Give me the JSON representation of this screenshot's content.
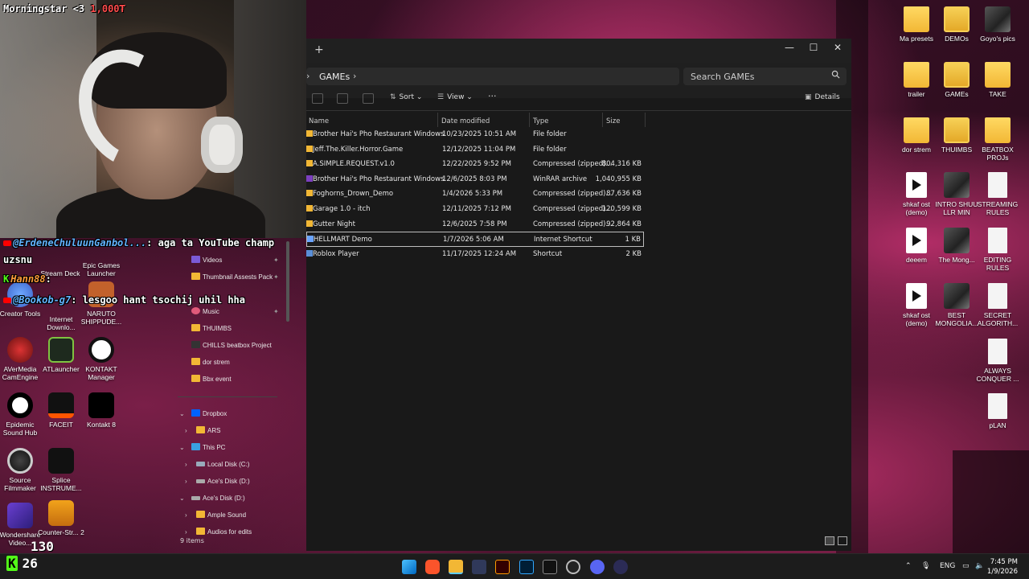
{
  "stream": {
    "donation_name": "Morningstar <3",
    "donation_amount": "1,000₮",
    "viewer_count": "26",
    "follower_counter": "130"
  },
  "chat": [
    {
      "user": "@ErdeneChuluunGanbol...",
      "text": ": aga ta YouTube champ",
      "cont": "uzsnu"
    },
    {
      "user": "Hann88",
      "text": ":"
    },
    {
      "user": "@Bookob-g7",
      "text": ": lesgoo hant tsochij uhil hha"
    }
  ],
  "desktop_left_icons": [
    {
      "label": "Stream Deck"
    },
    {
      "label": "Epic Games Launcher"
    },
    {
      "label": "Creator Tools"
    },
    {
      "label": "Internet Downlo..."
    },
    {
      "label": "NARUTO SHIPPUDE..."
    },
    {
      "label": "AVerMedia CamEngine"
    },
    {
      "label": "ATLauncher"
    },
    {
      "label": "KONTAKT Manager"
    },
    {
      "label": "Epidemic Sound Hub"
    },
    {
      "label": "FACEIT"
    },
    {
      "label": "Kontakt 8"
    },
    {
      "label": "Source Filmmaker"
    },
    {
      "label": "Splice INSTRUME..."
    },
    {
      "label": "Wondershare Video..."
    },
    {
      "label": "Counter-Str... 2"
    }
  ],
  "desktop_right_icons": [
    {
      "label": "Ma presets"
    },
    {
      "label": "DEMOs"
    },
    {
      "label": "Goyo's pics"
    },
    {
      "label": "trailer"
    },
    {
      "label": "GAMEs"
    },
    {
      "label": "TAKE"
    },
    {
      "label": "dor strem"
    },
    {
      "label": "THUIMBS"
    },
    {
      "label": "BEATBOX PROJs"
    },
    {
      "label": "shkaf ost (demo)"
    },
    {
      "label": "INTRO SHUU LLR MIN"
    },
    {
      "label": "STREAMING RULES"
    },
    {
      "label": "deeem"
    },
    {
      "label": "The Mong..."
    },
    {
      "label": "EDITING RULES"
    },
    {
      "label": "shkaf ost (demo)"
    },
    {
      "label": "BEST MONGOLIA..."
    },
    {
      "label": "SECRET ALGORITH..."
    },
    {
      "label": "ALWAYS CONQUER ..."
    },
    {
      "label": "pLAN"
    }
  ],
  "explorer": {
    "new_tab": "+",
    "breadcrumb": "GAMEs",
    "search_placeholder": "Search GAMEs",
    "toolbar": {
      "sort": "Sort",
      "view": "View",
      "more": "···",
      "details": "Details"
    },
    "columns": {
      "name": "Name",
      "date": "Date modified",
      "type": "Type",
      "size": "Size"
    },
    "files": [
      {
        "name": "Brother Hai's Pho Restaurant Windows",
        "date": "10/23/2025 10:51 AM",
        "type": "File folder",
        "size": "",
        "kind": "folder"
      },
      {
        "name": "Jeff.The.Killer.Horror.Game",
        "date": "12/12/2025 11:04 PM",
        "type": "File folder",
        "size": "",
        "kind": "folder"
      },
      {
        "name": "A.SIMPLE.REQUEST.v1.0",
        "date": "12/22/2025 9:52 PM",
        "type": "Compressed (zipped)...",
        "size": "804,316 KB",
        "kind": "zip"
      },
      {
        "name": "Brother Hai's Pho Restaurant Windows",
        "date": "12/6/2025 8:03 PM",
        "type": "WinRAR archive",
        "size": "1,040,955 KB",
        "kind": "rar"
      },
      {
        "name": "Foghorns_Drown_Demo",
        "date": "1/4/2026 5:33 PM",
        "type": "Compressed (zipped)...",
        "size": "87,636 KB",
        "kind": "zip"
      },
      {
        "name": "Garage 1.0 - itch",
        "date": "12/11/2025 7:12 PM",
        "type": "Compressed (zipped)...",
        "size": "120,599 KB",
        "kind": "zip"
      },
      {
        "name": "Gutter Night",
        "date": "12/6/2025 7:58 PM",
        "type": "Compressed (zipped)...",
        "size": "92,864 KB",
        "kind": "zip"
      },
      {
        "name": "HELLMART Demo",
        "date": "1/7/2026 5:06 AM",
        "type": "Internet Shortcut",
        "size": "1 KB",
        "kind": "url"
      },
      {
        "name": "Roblox Player",
        "date": "11/17/2025 12:24 AM",
        "type": "Shortcut",
        "size": "2 KB",
        "kind": "lnk"
      }
    ],
    "status": "9 items"
  },
  "navpane": [
    {
      "label": "Videos",
      "pinned": true
    },
    {
      "label": "Thumbnail Assests Pack",
      "pinned": true
    },
    {
      "label": "Music",
      "pinned": true
    },
    {
      "label": "THUIMBS"
    },
    {
      "label": "CHILLS beatbox Project"
    },
    {
      "label": "dor strem"
    },
    {
      "label": "Bbx event"
    },
    {
      "label": "Dropbox"
    },
    {
      "label": "ARS"
    },
    {
      "label": "This PC"
    },
    {
      "label": "Local Disk (C:)"
    },
    {
      "label": "Ace's Disk (D:)"
    },
    {
      "label": "Ace's Disk (D:)"
    },
    {
      "label": "Ample Sound"
    },
    {
      "label": "Audios for edits"
    }
  ],
  "taskbar": {
    "lang": "ENG",
    "time": "7:45 PM",
    "date": "1/9/2026"
  },
  "colors": {
    "accent": "#0078d4",
    "folder": "#f2b735",
    "kick": "#53fc18"
  }
}
